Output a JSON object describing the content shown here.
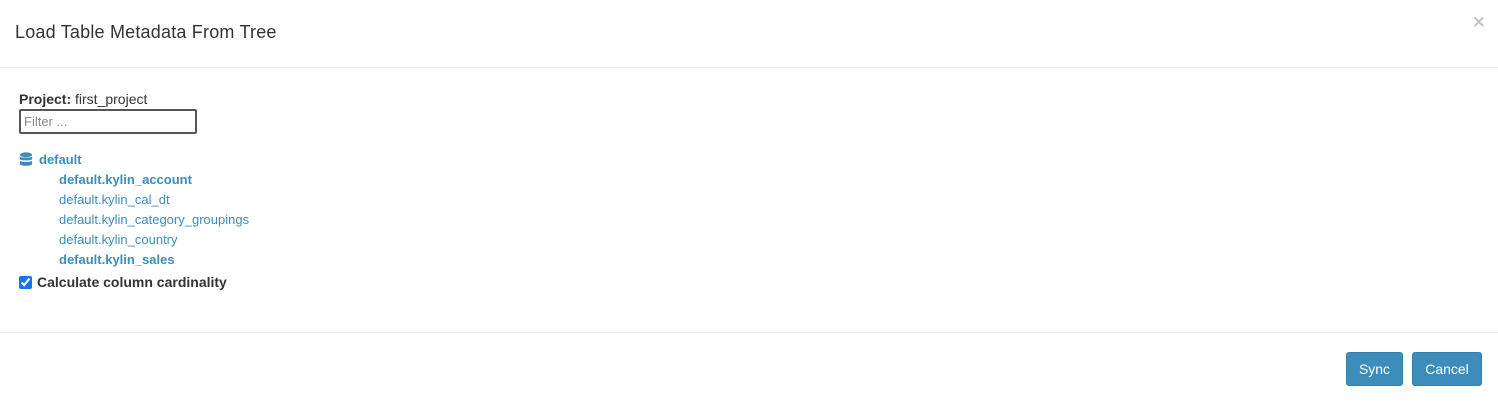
{
  "dialog": {
    "title": "Load Table Metadata From Tree",
    "close_symbol": "×"
  },
  "project": {
    "label": "Project:",
    "value": "first_project"
  },
  "filter": {
    "placeholder": "Filter ...",
    "value": ""
  },
  "tree": {
    "root": {
      "label": "default",
      "icon": "database-icon"
    },
    "children": [
      {
        "label": "default.kylin_account",
        "bold": true
      },
      {
        "label": "default.kylin_cal_dt",
        "bold": false
      },
      {
        "label": "default.kylin_category_groupings",
        "bold": false
      },
      {
        "label": "default.kylin_country",
        "bold": false
      },
      {
        "label": "default.kylin_sales",
        "bold": true
      }
    ]
  },
  "cardinality": {
    "label": "Calculate column cardinality",
    "checked": true
  },
  "footer": {
    "sync_label": "Sync",
    "cancel_label": "Cancel"
  },
  "colors": {
    "accent": "#3c8dbc",
    "text": "#333333",
    "divider": "#e9ecef"
  }
}
